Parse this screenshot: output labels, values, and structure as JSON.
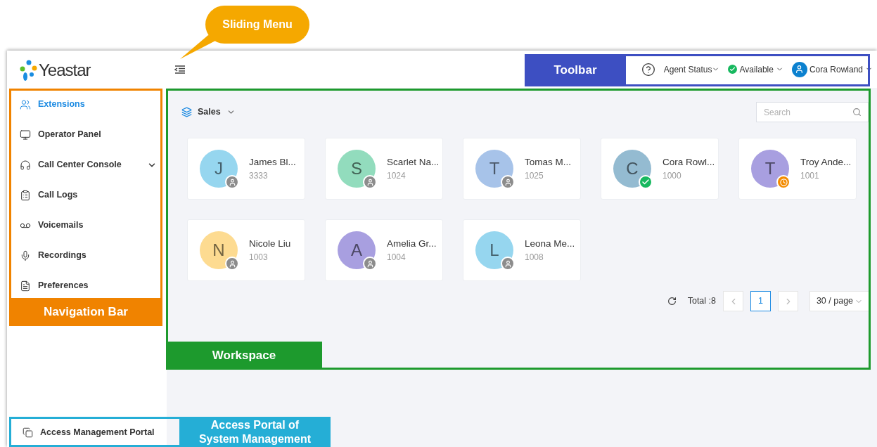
{
  "logo": {
    "text": "Yeastar"
  },
  "nav": {
    "items": [
      {
        "label": "Extensions",
        "selected": true,
        "expandable": false
      },
      {
        "label": "Operator Panel",
        "selected": false,
        "expandable": false
      },
      {
        "label": "Call Center Console",
        "selected": false,
        "expandable": true
      },
      {
        "label": "Call Logs",
        "selected": false,
        "expandable": false
      },
      {
        "label": "Voicemails",
        "selected": false,
        "expandable": false
      },
      {
        "label": "Recordings",
        "selected": false,
        "expandable": false
      },
      {
        "label": "Preferences",
        "selected": false,
        "expandable": false
      }
    ],
    "footer": "Access Management Portal"
  },
  "toolbar": {
    "agent_status": "Agent Status",
    "status": "Available",
    "user": "Cora Rowland"
  },
  "workspace": {
    "group": "Sales",
    "search": {
      "placeholder": "Search"
    },
    "contacts": [
      {
        "initial": "J",
        "name": "James Bl...",
        "ext": "3333",
        "color": "#96d6ef",
        "kind": "offline"
      },
      {
        "initial": "S",
        "name": "Scarlet Na...",
        "ext": "1024",
        "color": "#92dcbd",
        "kind": "offline"
      },
      {
        "initial": "T",
        "name": "Tomas M...",
        "ext": "1025",
        "color": "#a7c3e9",
        "kind": "offline"
      },
      {
        "initial": "C",
        "name": "Cora Rowl...",
        "ext": "1000",
        "color": "#94bbd1",
        "kind": "available"
      },
      {
        "initial": "T",
        "name": "Troy Ande...",
        "ext": "1001",
        "color": "#a89fe0",
        "kind": "away"
      },
      {
        "initial": "N",
        "name": "Nicole Liu",
        "ext": "1003",
        "color": "#fddb91",
        "kind": "offline"
      },
      {
        "initial": "A",
        "name": "Amelia Gr...",
        "ext": "1004",
        "color": "#a89fe0",
        "kind": "offline"
      },
      {
        "initial": "L",
        "name": "Leona Me...",
        "ext": "1008",
        "color": "#96d6ef",
        "kind": "offline"
      }
    ],
    "pagination": {
      "total": "Total :8",
      "pages": [
        {
          "label": "1",
          "selected": true
        }
      ],
      "page_size": "30 / page"
    }
  },
  "annotations": [
    {
      "kind": "bubble",
      "text": "Sliding Menu",
      "color": "#f5a800"
    },
    {
      "kind": "toolbar",
      "text": "Toolbar",
      "color": "#3d4fc2"
    },
    {
      "kind": "nav",
      "text": "Navigation Bar",
      "color": "#f08300"
    },
    {
      "kind": "workspace",
      "text": "Workspace",
      "color": "#1d9a2d"
    },
    {
      "kind": "portal",
      "text": "Access Portal of System Management",
      "color": "#25aed6"
    }
  ]
}
